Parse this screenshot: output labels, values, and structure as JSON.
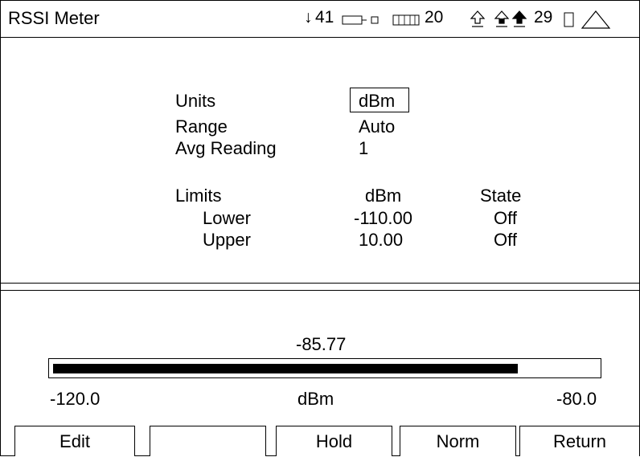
{
  "header": {
    "title": "RSSI Meter",
    "status": {
      "signal_count": "41",
      "channel_count": "20",
      "last_count": "29"
    }
  },
  "settings": {
    "units_label": "Units",
    "units_value": "dBm",
    "range_label": "Range",
    "range_value": "Auto",
    "avg_label": "Avg Reading",
    "avg_value": "1"
  },
  "limits": {
    "title": "Limits",
    "col_units": "dBm",
    "col_state": "State",
    "rows": [
      {
        "name": "Lower",
        "value": "-110.00",
        "state": "Off"
      },
      {
        "name": "Upper",
        "value": "10.00",
        "state": "Off"
      }
    ]
  },
  "meter": {
    "reading": "-85.77",
    "reading_value": -85.77,
    "min_label": "-120.0",
    "max_label": "-80.0",
    "unit": "dBm",
    "min": -120.0,
    "max": -80.0
  },
  "softkeys": [
    "Edit",
    "",
    "Hold",
    "Norm",
    "Return"
  ]
}
